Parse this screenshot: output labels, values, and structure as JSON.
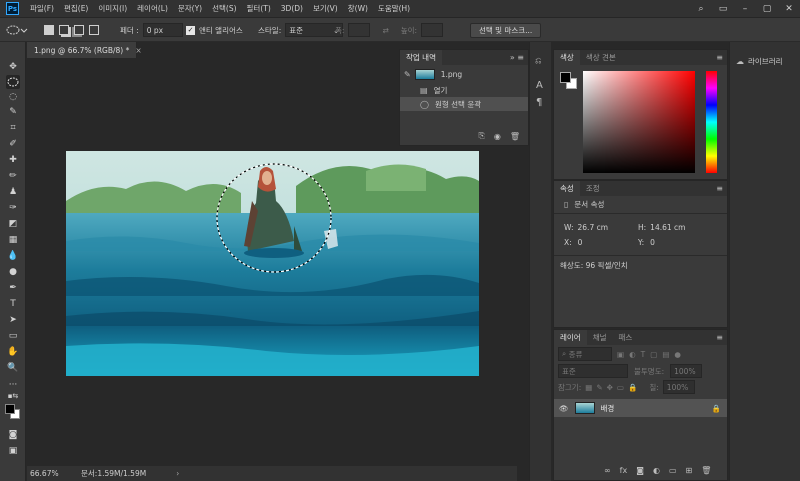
{
  "menu": {
    "logo": "Ps",
    "items": [
      "파일(F)",
      "편집(E)",
      "이미지(I)",
      "레이어(L)",
      "문자(Y)",
      "선택(S)",
      "필터(T)",
      "3D(D)",
      "보기(V)",
      "창(W)",
      "도움말(H)"
    ]
  },
  "window_controls": [
    "⌕",
    "▭",
    "–",
    "▢",
    "✕"
  ],
  "options": {
    "feather_label": "페더 :",
    "feather_value": "0 px",
    "antialias_label": "앤티 앨리어스",
    "antialias_checked": true,
    "style_label": "스타일:",
    "style_value": "표준",
    "width_label": "폭:",
    "height_label": "높이:",
    "select_mask_button": "선택 및 마스크..."
  },
  "document": {
    "tab_title": "1.png @ 66.7% (RGB/8) *",
    "zoom": "66.67%",
    "doc_size": "문서:1.59M/1.59M"
  },
  "history": {
    "tab": "작업 내역",
    "snapshot": "1.png",
    "items": [
      {
        "label": "열기",
        "icon": "document-icon",
        "selected": false
      },
      {
        "label": "원형 선택 윤곽",
        "icon": "ellipse-marquee-icon",
        "selected": true
      }
    ]
  },
  "color_panel": {
    "tabs": [
      "색상",
      "색상 견본"
    ],
    "fg_color": "#000000",
    "bg_color": "#ffffff",
    "hue_color": "#ff0000"
  },
  "libraries": {
    "label": "라이브러리"
  },
  "properties": {
    "tabs": [
      "속성",
      "조정"
    ],
    "title": "문서 속성",
    "w_label": "W:",
    "w_value": "26.7 cm",
    "h_label": "H:",
    "h_value": "14.61 cm",
    "x_label": "X:",
    "x_value": "0",
    "y_label": "Y:",
    "y_value": "0",
    "resolution": "해상도: 96 픽셀/인치"
  },
  "layers": {
    "tabs": [
      "레이어",
      "채널",
      "패스"
    ],
    "filter_placeholder": "종류",
    "blend_mode": "표준",
    "opacity_label": "불투명도:",
    "opacity_value": "100%",
    "lock_label": "잠그기:",
    "fill_label": "칠:",
    "fill_value": "100%",
    "layer_name": "배경"
  }
}
